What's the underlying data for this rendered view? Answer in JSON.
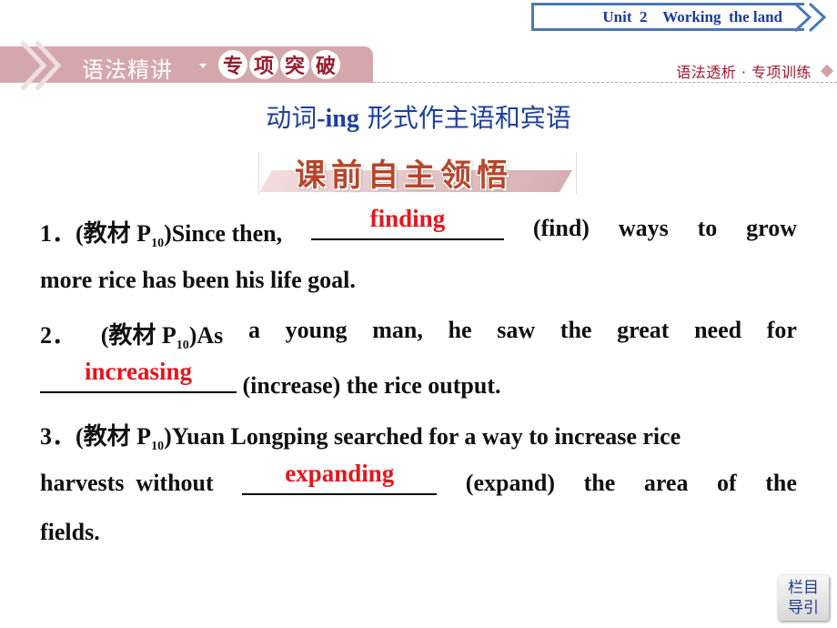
{
  "header": {
    "unit_title": "Unit  2    Working  the land",
    "section_title": "语法精讲",
    "section_circles": [
      "专",
      "项",
      "突",
      "破"
    ],
    "right_label": "语法透析 · 专项训练"
  },
  "topic": {
    "prefix": "动词",
    "keyword": "-ing",
    "suffix": " 形式作主语和宾语"
  },
  "banner": "课前自主领悟",
  "items": [
    {
      "num": "1．",
      "source": "(教材 P",
      "source_sub": "10",
      "line1_after": ")Since then,",
      "answer": "finding",
      "line1_tail": [
        "(find)",
        "ways",
        "to",
        "grow"
      ],
      "line2": "more rice has been his life goal."
    },
    {
      "num": "2．",
      "source": "(教材  P",
      "source_sub": "10",
      "line1_words": [
        ")As",
        "a",
        "young",
        "man,",
        "he",
        "saw",
        "the",
        "great",
        "need",
        "for"
      ],
      "answer": "increasing",
      "line2_tail": "(increase) the rice output."
    },
    {
      "num": "3．",
      "source": "(教材 P",
      "source_sub": "10",
      "line1_after": ")Yuan Longping searched for a way to increase rice",
      "line2_head": "harvests  without",
      "answer": "expanding",
      "line2_tail": [
        "(expand)",
        "the",
        "area",
        "of",
        "the"
      ],
      "line3": "fields."
    }
  ],
  "nav_button": {
    "line1": "栏目",
    "line2": "导引"
  },
  "colors": {
    "answer": "#e8141c",
    "topic": "#1e3fa0",
    "section_bar": "#d4a8ab",
    "unit_border": "#4a78b4"
  }
}
